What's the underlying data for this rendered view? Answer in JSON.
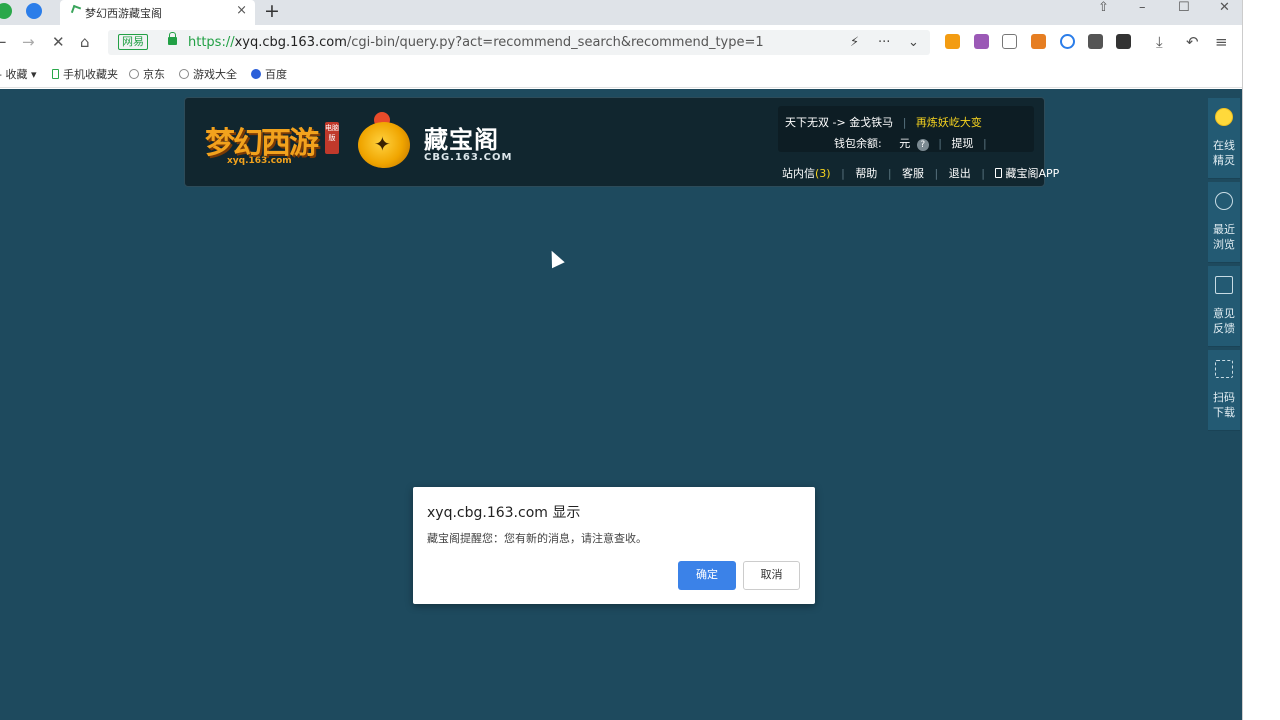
{
  "browser": {
    "tab": {
      "title": "梦幻西游藏宝阁",
      "close": "×"
    },
    "new_tab": "+",
    "window_controls": {
      "minimize": "–",
      "maximize": "☐",
      "close": "✕"
    },
    "nav": {
      "back": "←",
      "forward": "→",
      "stop": "✕",
      "home": "⌂"
    },
    "address": {
      "badge": "网易",
      "scheme": "https://",
      "host": "xyq.cbg.163.com",
      "path": "/cgi-bin/query.py?act=recommend_search&recommend_type=1"
    },
    "address_actions": {
      "bolt": "⚡",
      "more": "···",
      "dropdown": "⌄"
    },
    "toolbar_right": {
      "download": "⤓",
      "undo": "↶",
      "menu": "≡"
    },
    "bookmarks": {
      "favorites": "收藏",
      "items": [
        "手机收藏夹",
        "京东",
        "游戏大全",
        "百度"
      ]
    }
  },
  "site": {
    "logo_game": {
      "main": "梦幻西游",
      "tag": "电脑版",
      "sub": "xyq.163.com"
    },
    "logo_cbg": {
      "title": "藏宝阁",
      "sub": "CBG.163.COM"
    },
    "user": {
      "server": "天下无双",
      "arrow": "->",
      "region": "金戈铁马",
      "promo": "再炼妖屹大变",
      "balance_label": "钱包余额:",
      "balance_unit": "元",
      "withdraw": "提现"
    },
    "nav": {
      "messages": "站内信",
      "message_count": "(3)",
      "help": "帮助",
      "service": "客服",
      "logout": "退出",
      "app": "藏宝阁APP"
    },
    "sidepanel": [
      {
        "label": "在线精灵",
        "icon": "assistant-face-icon"
      },
      {
        "label": "最近浏览",
        "icon": "clock-icon"
      },
      {
        "label": "意见反馈",
        "icon": "edit-icon"
      },
      {
        "label": "扫码下载",
        "icon": "scan-icon"
      }
    ]
  },
  "dialog": {
    "title": "xyq.cbg.163.com 显示",
    "message": "藏宝阁提醒您：您有新的消息，请注意查收。",
    "ok": "确定",
    "cancel": "取消"
  },
  "colors": {
    "page_bg": "#1e4a5e",
    "header_bg": "#11262f",
    "accent_yellow": "#f5d21f",
    "primary_button": "#3b82e8",
    "url_green": "#22a045"
  }
}
